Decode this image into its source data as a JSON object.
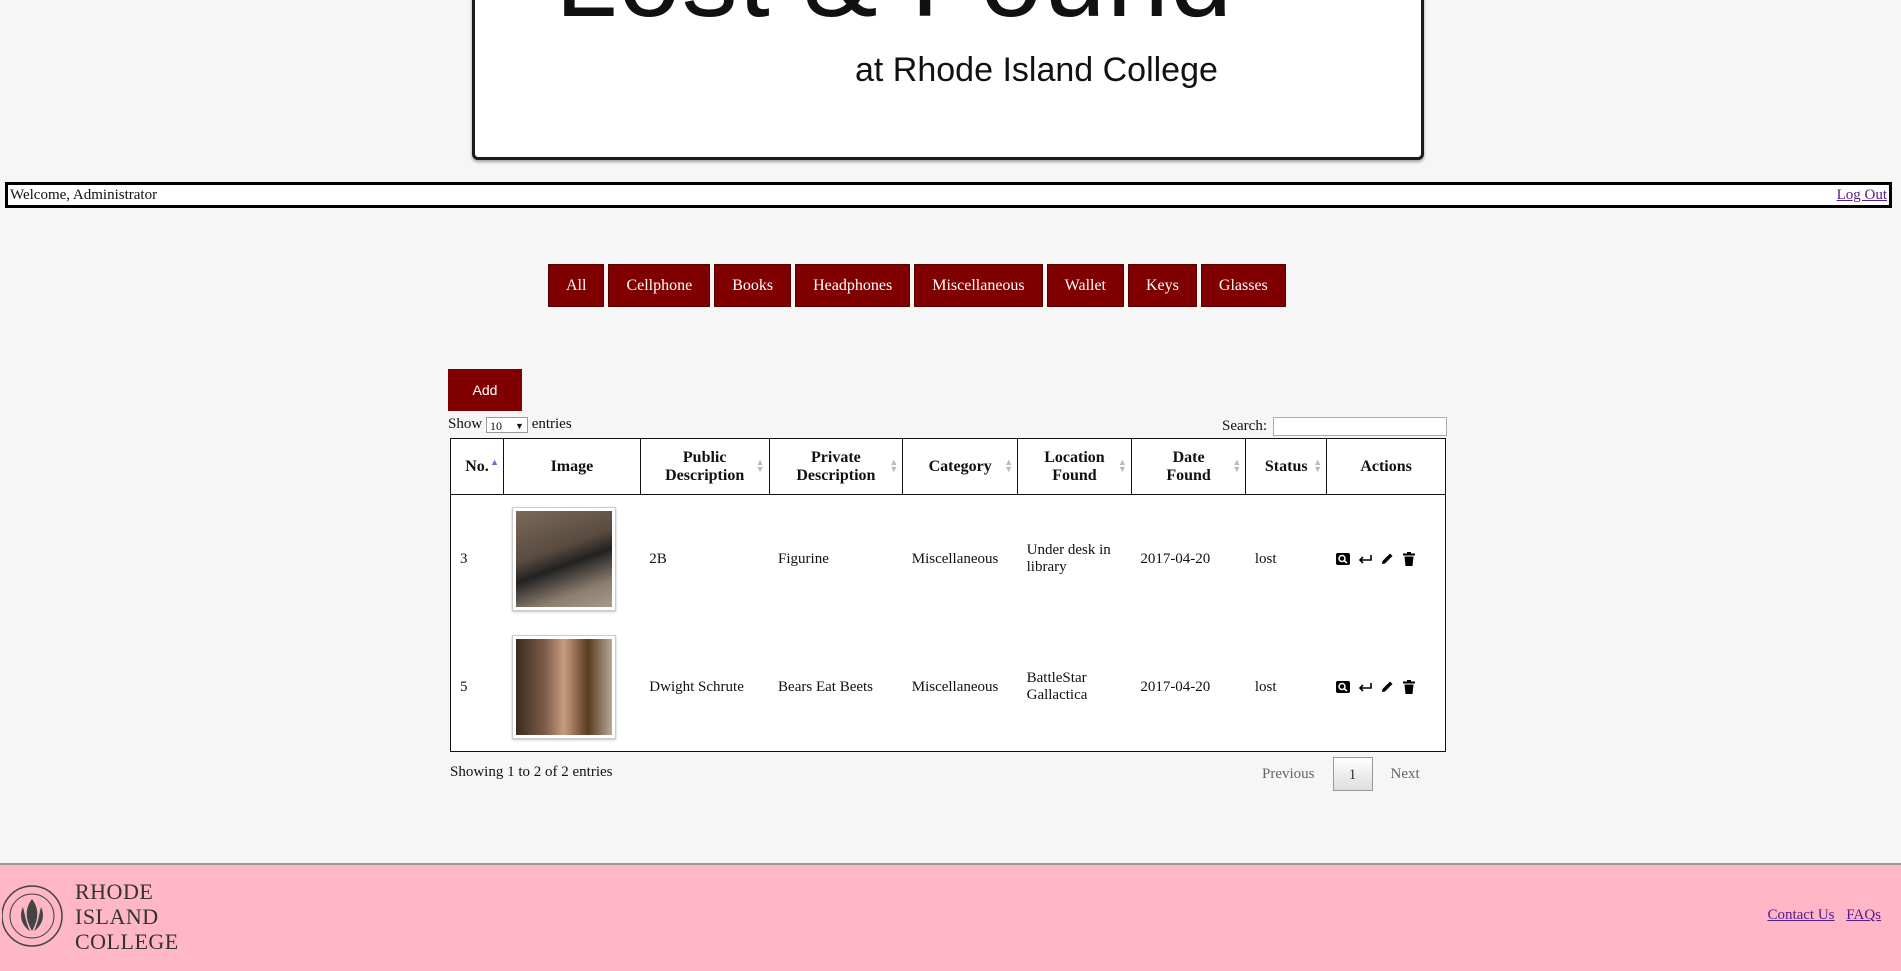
{
  "header": {
    "logo_title": "Lost & Found",
    "logo_subtitle": "at Rhode Island College"
  },
  "welcome": {
    "text": "Welcome, Administrator",
    "logout": "Log Out"
  },
  "categories": [
    "All",
    "Cellphone",
    "Books",
    "Headphones",
    "Miscellaneous",
    "Wallet",
    "Keys",
    "Glasses"
  ],
  "add_label": "Add",
  "length": {
    "show": "Show",
    "value": "10",
    "entries": "entries"
  },
  "search_label": "Search:",
  "table": {
    "headers": [
      {
        "line1": "No.",
        "line2": ""
      },
      {
        "line1": "Image",
        "line2": ""
      },
      {
        "line1": "Public",
        "line2": "Description"
      },
      {
        "line1": "Private",
        "line2": "Description"
      },
      {
        "line1": "Category",
        "line2": ""
      },
      {
        "line1": "Location",
        "line2": "Found"
      },
      {
        "line1": "Date",
        "line2": "Found"
      },
      {
        "line1": "Status",
        "line2": ""
      },
      {
        "line1": "Actions",
        "line2": ""
      }
    ],
    "rows": [
      {
        "no": "3",
        "public": "2B",
        "private": "Figurine",
        "category": "Miscellaneous",
        "loc1": "Under desk in",
        "loc2": "library",
        "date": "2017-04-20",
        "status": "lost"
      },
      {
        "no": "5",
        "public": "Dwight Schrute",
        "private": "Bears Eat Beets",
        "category": "Miscellaneous",
        "loc1": "BattleStar",
        "loc2": "Gallactica",
        "date": "2017-04-20",
        "status": "lost"
      }
    ]
  },
  "info": "Showing 1 to 2 of 2 entries",
  "pager": {
    "previous": "Previous",
    "page": "1",
    "next": "Next"
  },
  "footer": {
    "college_line1": "RHODE",
    "college_line2": "ISLAND",
    "college_line3": "COLLEGE",
    "contact": "Contact Us",
    "faqs": "FAQs"
  },
  "icons": [
    "view-icon",
    "return-icon",
    "edit-icon",
    "delete-icon"
  ],
  "colors": {
    "brand": "#800000",
    "footer": "#ffb6c6"
  }
}
